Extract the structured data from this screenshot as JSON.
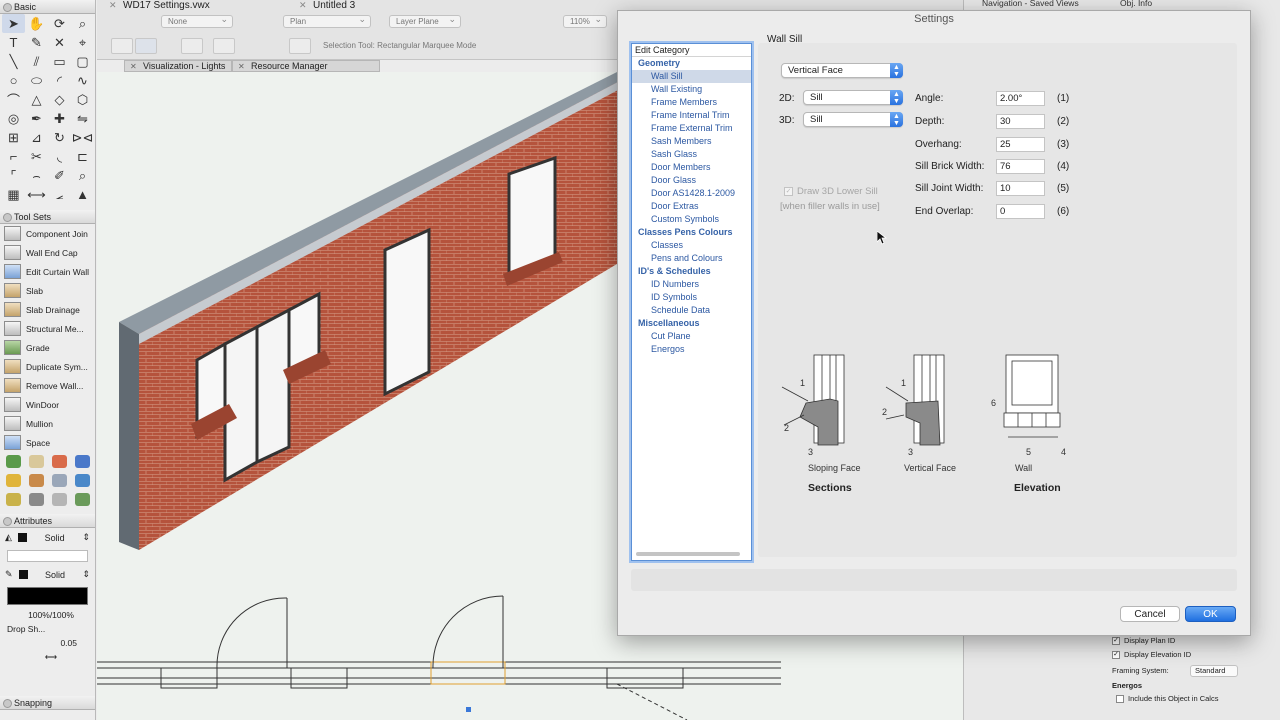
{
  "app": {
    "doc_tabs": [
      "WD17 Settings.vwx",
      "Untitled 3"
    ],
    "class_dropdown": "None",
    "view_dropdown": "Plan",
    "layer_plane_dropdown": "Layer Plane",
    "zoom": "110%",
    "mode_bar_text": "Selection Tool: Rectangular Marquee Mode",
    "floating_tabs": [
      "Visualization - Lights",
      "Resource Manager"
    ]
  },
  "palettes": {
    "basic_title": "Basic",
    "tool_sets_title": "Tool Sets",
    "tool_sets": [
      "Component Join",
      "Wall End Cap",
      "Edit Curtain Wall",
      "Slab",
      "Slab Drainage",
      "Structural Me...",
      "Grade",
      "Duplicate Sym...",
      "Remove Wall...",
      "WinDoor",
      "Mullion",
      "Space"
    ],
    "attributes_title": "Attributes",
    "fill_style": "Solid",
    "pen_style": "Solid",
    "opacity": "100%/100%",
    "drop_shadow": "Drop Sh...",
    "line_weight": "0.05",
    "snapping_title": "Snapping"
  },
  "right_panels": {
    "navigation_title": "Navigation - Saved Views",
    "obj_info_title": "Obj. Info",
    "display_plan_id": "Display Plan ID",
    "display_elevation_id": "Display Elevation ID",
    "framing_system_label": "Framing System:",
    "framing_system_value": "Standard",
    "energos_label": "Energos",
    "include_in_calcs": "Include this Object in Calcs"
  },
  "dialog": {
    "title": "Settings",
    "edit_category_label": "Edit Category",
    "categories": [
      {
        "group": "Geometry",
        "items": [
          "Wall Sill",
          "Wall Existing",
          "Frame Members",
          "Frame Internal Trim",
          "Frame External Trim",
          "Sash Members",
          "Sash Glass",
          "Door Members",
          "Door Glass",
          "Door AS1428.1-2009",
          "Door Extras",
          "Custom Symbols"
        ]
      },
      {
        "group": "Classes Pens Colours",
        "items": [
          "Classes",
          "Pens and Colours"
        ]
      },
      {
        "group": "ID's & Schedules",
        "items": [
          "ID Numbers",
          "ID Symbols",
          "Schedule Data"
        ]
      },
      {
        "group": "Miscellaneous",
        "items": [
          "Cut Plane",
          "Energos"
        ]
      }
    ],
    "active_category": "Wall Sill",
    "section_title": "Wall Sill",
    "style_popup": "Vertical Face",
    "label_2d": "2D:",
    "value_2d": "Sill",
    "label_3d": "3D:",
    "value_3d": "Sill",
    "params": [
      {
        "label": "Angle:",
        "value": "2.00°",
        "ref": "(1)"
      },
      {
        "label": "Depth:",
        "value": "30",
        "ref": "(2)"
      },
      {
        "label": "Overhang:",
        "value": "25",
        "ref": "(3)"
      },
      {
        "label": "Sill Brick Width:",
        "value": "76",
        "ref": "(4)"
      },
      {
        "label": "Sill Joint Width:",
        "value": "10",
        "ref": "(5)"
      },
      {
        "label": "End Overlap:",
        "value": "0",
        "ref": "(6)"
      }
    ],
    "draw_lower_sill": "Draw 3D Lower Sill",
    "draw_lower_sill_note": "[when filler walls in use]",
    "diagram_captions": {
      "sloping": "Sloping Face",
      "vertical": "Vertical Face",
      "wall": "Wall",
      "sections": "Sections",
      "elevation": "Elevation"
    },
    "diagram_numbers": [
      "1",
      "2",
      "3",
      "4",
      "5",
      "6"
    ],
    "cancel_label": "Cancel",
    "ok_label": "OK"
  },
  "colors": {
    "accent": "#2a72df",
    "category_link": "#2c58a2",
    "brick": "#b5533c",
    "selection": "#cfd9e8"
  }
}
